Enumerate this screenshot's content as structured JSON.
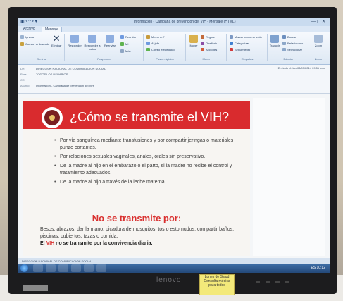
{
  "window": {
    "title": "Información - Campaña de prevención del VIH - Mensaje (HTML)",
    "quick_access": "▣ ↶ ↷ ▾",
    "controls": "— ▢ ✕"
  },
  "tabs": [
    "Archivo",
    "Mensaje"
  ],
  "ribbon": {
    "groups": [
      "Eliminar",
      "Responder",
      "Pasos rápidos",
      "Mover",
      "Etiquetas",
      "Edición",
      "Zoom"
    ],
    "buttons": {
      "ignore": "Ignorar",
      "junk": "Correo no deseado",
      "delete": "Eliminar",
      "reply": "Responder",
      "reply_all": "Responder a todos",
      "forward": "Reenviar",
      "reunion": "Reunión",
      "im": "MI",
      "more": "Más",
      "move_to": "Mover a: ?",
      "to_manager": "Al jefe",
      "team_email": "Correo electrónico",
      "move": "Mover",
      "rules": "Reglas",
      "onenote": "OneNote",
      "actions": "Acciones",
      "mark_unread": "Marcar como no leído",
      "categorize": "Categorizar",
      "follow_up": "Seguimiento",
      "translate": "Traducir",
      "find": "Buscar",
      "related": "Relacionado",
      "select": "Seleccionar",
      "zoom": "Zoom"
    }
  },
  "header": {
    "labels": [
      "De:",
      "Para:",
      "CC:",
      "Asunto:"
    ],
    "from": "DIRECCION NACIONAL DE COMUNICACION SOCIAL",
    "to": "TODOS LOS USUARIOS",
    "cc": "",
    "subject": "Información - Campaña de prevención del VIH",
    "date": "Enviado el: lun 03/03/2014 09:51 a.m."
  },
  "poster": {
    "headline": "¿Cómo se transmite el  VIH?",
    "bullets": [
      "Por vía sanguínea mediante transfusiones y por compartir jeringas o materiales punzo cortantes.",
      "Por relaciones sexuales vaginales, anales, orales sin preservativo.",
      "De la madre al hijo en el embarazo o el parto, si la madre no recibe el control y tratamiento adecuados.",
      "De la madre al hijo a través de la leche materna."
    ],
    "no_title": "No se transmite por:",
    "no_text": "Besos, abrazos, dar la mano, picadura de mosquitos, tos o estornudos, compartir baños, piscinas, cubiertos, tazas o comida.",
    "closing_prefix": "El ",
    "closing_highlight": "VIH",
    "closing_suffix": " no se transmite por la convivencia diaria."
  },
  "statusbar": "DIRECCION NACIONAL DE COMUNICACION SOCIAL",
  "tray": "ES  10:12",
  "monitor": {
    "brand": "lenovo",
    "model_label": "",
    "sticker": "Lunes de Salud Consulta médica para todos"
  },
  "colors": {
    "accent_red": "#d92b2e",
    "ribbon_blue": "#dbe7f5",
    "taskbar": "#24497a"
  }
}
